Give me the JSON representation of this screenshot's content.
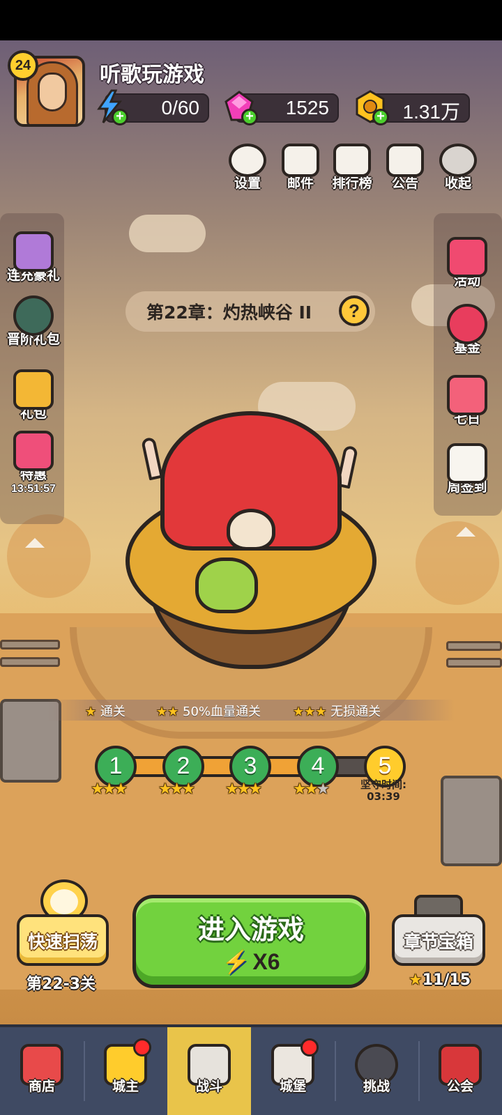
{
  "player": {
    "name": "听歌玩游戏",
    "level": "24"
  },
  "resources": {
    "energy": "0/60",
    "gems": "1525",
    "gold": "1.31万"
  },
  "top_buttons": [
    "设置",
    "邮件",
    "排行榜",
    "公告",
    "收起"
  ],
  "left_side": [
    {
      "label": "连充豪礼"
    },
    {
      "label": "晋阶礼包"
    },
    {
      "label": "礼包"
    },
    {
      "label": "特惠",
      "timer": "13:51:57"
    }
  ],
  "right_side": [
    "活动",
    "基金",
    "七日",
    "周签到"
  ],
  "chapter": {
    "title": "第22章：灼热峡谷 II",
    "help": "?"
  },
  "objectives": [
    {
      "stars": "★",
      "label": "通关"
    },
    {
      "stars": "★★",
      "label": "50%血量通关"
    },
    {
      "stars": "★★★",
      "label": "无损通关"
    }
  ],
  "stages": [
    {
      "num": "1",
      "stars_on": "★★★",
      "stars_off": ""
    },
    {
      "num": "2",
      "stars_on": "★★★",
      "stars_off": ""
    },
    {
      "num": "3",
      "stars_on": "★★★",
      "stars_off": ""
    },
    {
      "num": "4",
      "stars_on": "★★",
      "stars_off": "★"
    },
    {
      "num": "5"
    }
  ],
  "defend": {
    "label": "坚守时间:",
    "time": "03:39"
  },
  "actions": {
    "sweep_label": "快速扫荡",
    "sweep_stage": "第22-3关",
    "play_label": "进入游戏",
    "play_cost": "X6",
    "chest_label": "章节宝箱",
    "chest_progress": "11/15"
  },
  "nav": [
    "商店",
    "城主",
    "战斗",
    "城堡",
    "挑战",
    "公会"
  ],
  "colors": {
    "accent_green": "#72d23e",
    "nav_bg": "#3f4a63",
    "nav_active": "#e9c44a"
  }
}
